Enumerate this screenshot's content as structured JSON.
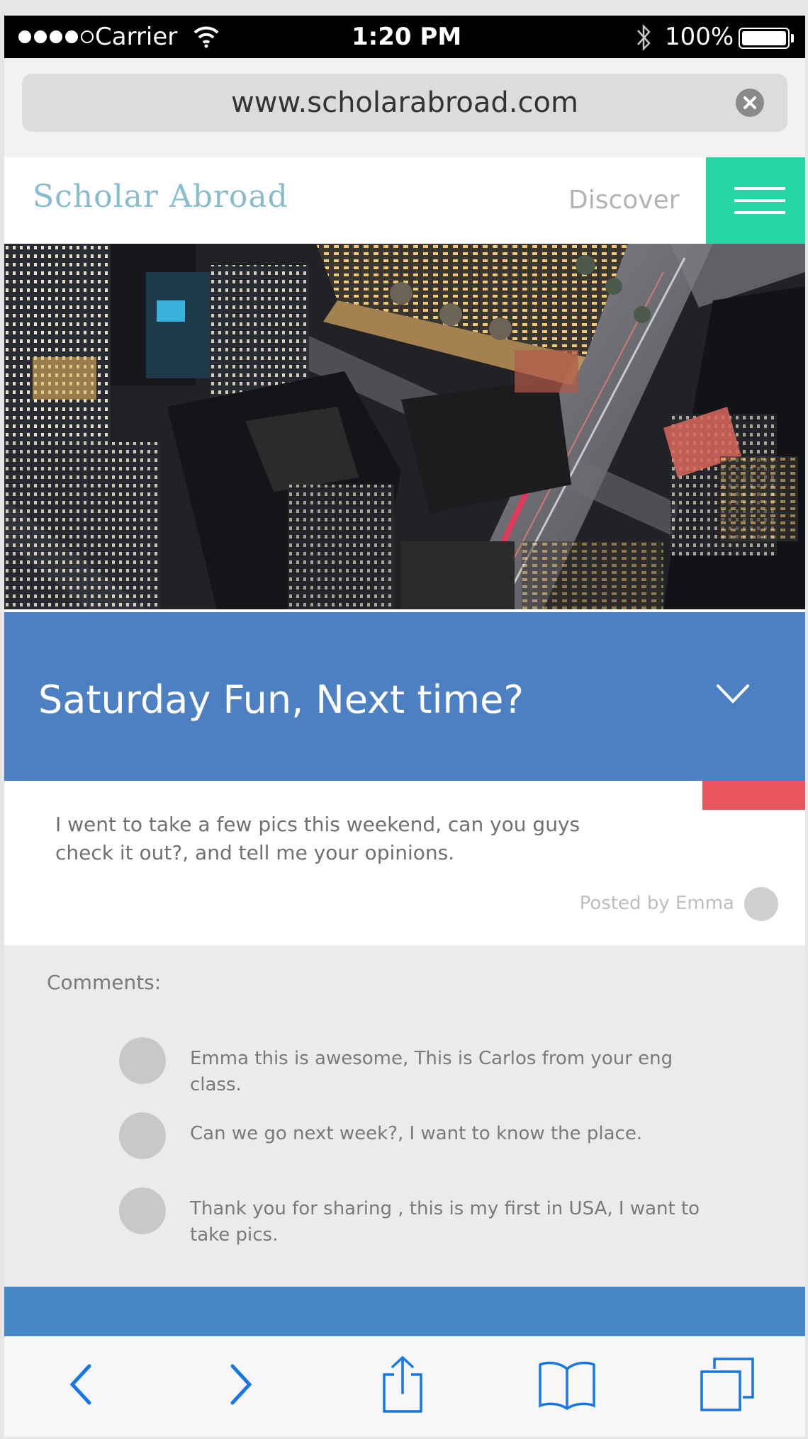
{
  "status_bar": {
    "carrier": "Carrier",
    "time": "1:20 PM",
    "battery": "100%",
    "battery_level": 1.0
  },
  "browser": {
    "url": "www.scholarabroad.com"
  },
  "site": {
    "logo": "Scholar Abroad",
    "nav_discover": "Discover"
  },
  "post": {
    "title": "Saturday Fun, Next time?",
    "body": "I went to take a few pics this weekend, can you guys check it out?, and tell me your opinions.",
    "posted_by": "Posted by Emma"
  },
  "comments": {
    "label": "Comments:",
    "items": [
      {
        "text": "Emma this is awesome, This is Carlos from your eng class."
      },
      {
        "text": "Can we go next week?, I want to know the place."
      },
      {
        "text": "Thank you for sharing , this is my first in USA, I want to take pics."
      }
    ]
  },
  "colors": {
    "accent_green": "#24d7a5",
    "post_blue": "#4c80c3",
    "tag_red": "#e8555a",
    "logo_blue": "#86bccb",
    "toolbar_blue": "#1877e6"
  },
  "icons": {
    "wifi": "wifi-icon",
    "bluetooth": "bluetooth-icon",
    "clear": "clear-icon",
    "menu": "hamburger-menu-icon",
    "chevron": "chevron-down-icon",
    "back": "back-arrow-icon",
    "forward": "forward-arrow-icon",
    "share": "share-icon",
    "bookmarks": "bookmarks-icon",
    "tabs": "tabs-icon"
  }
}
